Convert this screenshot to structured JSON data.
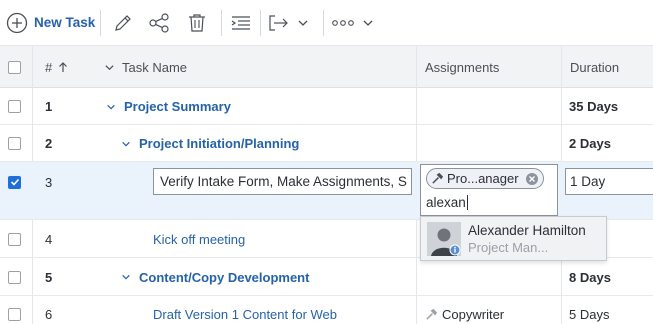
{
  "toolbar": {
    "new_task_label": "New Task",
    "icons": [
      "plus-circle-icon",
      "pencil-icon",
      "share-icon",
      "trash-icon",
      "indent-icon",
      "outdent-arrow-icon",
      "chevron-down-icon",
      "more-dots-icon",
      "chevron-down-icon"
    ]
  },
  "columns": {
    "number": "#",
    "task_name": "Task Name",
    "assignments": "Assignments",
    "duration": "Duration"
  },
  "rows": [
    {
      "num": "1",
      "name": "Project Summary",
      "duration": "35 Days",
      "bold": true,
      "expandable": true,
      "assignment": ""
    },
    {
      "num": "2",
      "name": "Project Initiation/Planning",
      "duration": "2 Days",
      "bold": true,
      "expandable": true,
      "assignment": ""
    },
    {
      "num": "3",
      "name": "Verify Intake Form, Make Assignments, S",
      "duration": "1 Day",
      "bold": false,
      "selected": true,
      "assignment_pill": "Pro...anager",
      "assignment_input": "alexan"
    },
    {
      "num": "4",
      "name": "Kick off meeting",
      "duration": "",
      "bold": false
    },
    {
      "num": "5",
      "name": "Content/Copy Development",
      "duration": "8 Days",
      "bold": true,
      "expandable": true
    },
    {
      "num": "6",
      "name": "Draft Version 1 Content for Web",
      "duration": "5 Days",
      "bold": false,
      "assignment": "Copywriter"
    }
  ],
  "autocomplete": {
    "name": "Alexander Hamilton",
    "role": "Project Man..."
  },
  "colors": {
    "accent": "#2563a8",
    "selected_row": "#eaf3fb",
    "checkbox_on": "#1e6fd9"
  }
}
